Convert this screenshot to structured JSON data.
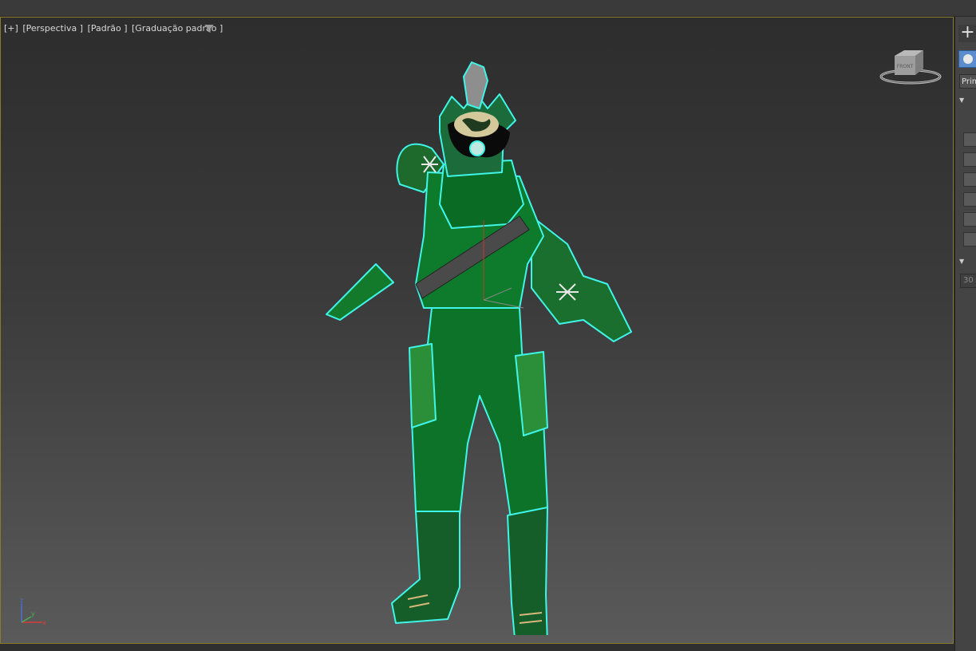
{
  "viewport": {
    "label_parts": [
      "[+]",
      "[Perspectiva ]",
      "[Padrão ]",
      "[Graduação padrão ]"
    ],
    "viewcube_face": "FRONT",
    "axis_labels": {
      "z": "z",
      "x": "x",
      "y": "y"
    }
  },
  "command_panel": {
    "create_icon": "+",
    "dropdown_value": "Prim",
    "numeric_field": "30"
  },
  "icons": {
    "filter": "filter-icon",
    "create": "plus-icon",
    "geometry": "sphere-icon",
    "viewcube": "viewcube-icon",
    "axis_tripod": "axis-tripod-icon"
  },
  "colors": {
    "viewport_border": "#8a7a2c",
    "selection_outline": "#3ff5e8",
    "model_green": "#0f7a2c",
    "active_button": "#5b8ccb"
  }
}
